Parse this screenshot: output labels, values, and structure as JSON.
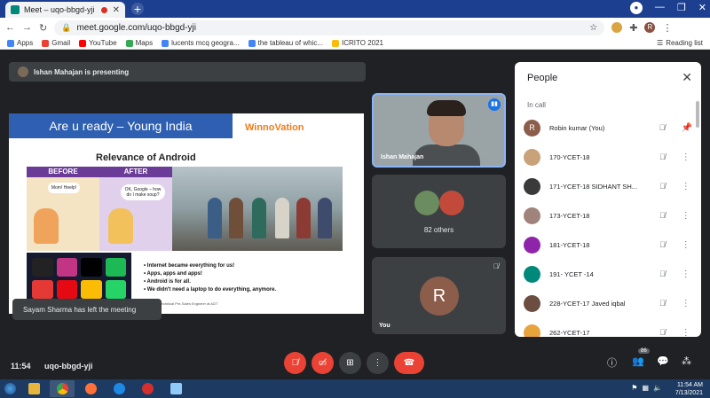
{
  "browser": {
    "tab_title": "Meet – uqo-bbgd-yji",
    "url": "meet.google.com/uqo-bbgd-yji",
    "bookmarks": [
      {
        "label": "Apps",
        "icon": "apps-grid-icon",
        "color": "#4285f4"
      },
      {
        "label": "Gmail",
        "icon": "gmail-icon",
        "color": "#ea4335"
      },
      {
        "label": "YouTube",
        "icon": "youtube-icon",
        "color": "#ff0000"
      },
      {
        "label": "Maps",
        "icon": "maps-icon",
        "color": "#34a853"
      },
      {
        "label": "lucents mcq geogra...",
        "icon": "google-icon",
        "color": "#4285f4"
      },
      {
        "label": "the tableau of whic...",
        "icon": "google-icon",
        "color": "#4285f4"
      },
      {
        "label": "ICRITO 2021",
        "icon": "shield-icon",
        "color": "#fbbc05"
      }
    ],
    "reading_list": "Reading list",
    "profile_initial": "R"
  },
  "meet": {
    "presenting_text": "Ishan Mahajan is presenting",
    "slide": {
      "banner": "Are u ready – Young India",
      "brand": "WinnoVation",
      "subtitle": "Relevance of Android",
      "before_label": "BEFORE",
      "after_label": "AFTER",
      "before_bubble": "Mom! Heelp!",
      "after_bubble": "OK, Google – how do I make soup?",
      "bullets": [
        "Internet became everything for us!",
        "Apps, apps and apps!",
        "Android is for all.",
        "We didn't need a laptop to do everything, anymore."
      ],
      "footer": "Mahajan, Technical Pre-Sales Engineer at ADT"
    },
    "toast": "Sayam Sharma has left the meeting",
    "tiles": {
      "presenter_name": "Ishan Mahajan",
      "others_label": "82 others",
      "you_label": "You",
      "you_initial": "R"
    },
    "people_panel": {
      "title": "People",
      "section": "In call",
      "participants": [
        {
          "name": "Robin kumar (You)",
          "avatar": "R",
          "color": "#8d5d4c"
        },
        {
          "name": "170-YCET-18",
          "avatar": "",
          "color": "#c9a27a"
        },
        {
          "name": "171-YCET-18 SIDHANT SH...",
          "avatar": "",
          "color": "#3a3a3a"
        },
        {
          "name": "173-YCET-18",
          "avatar": "",
          "color": "#a0837a"
        },
        {
          "name": "181-YCET-18",
          "avatar": "",
          "color": "#8e24aa"
        },
        {
          "name": "191- YCET -14",
          "avatar": "",
          "color": "#00897b"
        },
        {
          "name": "228-YCET-17 Javed iqbal",
          "avatar": "",
          "color": "#6d4c41"
        },
        {
          "name": "262-YCET-17",
          "avatar": "",
          "color": "#e8a33d"
        }
      ]
    },
    "bottom": {
      "time": "11:54",
      "meeting_code": "uqo-bbgd-yji",
      "people_count": "86"
    }
  },
  "taskbar": {
    "time": "11:54 AM",
    "date": "7/13/2021"
  }
}
